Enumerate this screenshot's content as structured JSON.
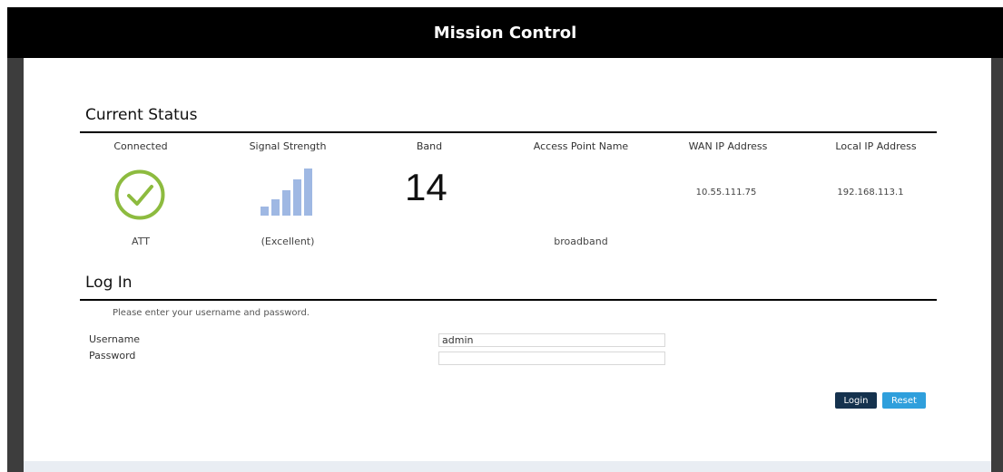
{
  "header": {
    "title": "Mission Control"
  },
  "status": {
    "title": "Current Status",
    "columns": {
      "connected": "Connected",
      "signal": "Signal Strength",
      "band": "Band",
      "apn": "Access Point Name",
      "wan": "WAN IP Address",
      "local": "Local IP Address"
    },
    "carrier": "ATT",
    "signal_quality": "(Excellent)",
    "band_value": "14",
    "apn_value": "broadband",
    "wan_ip": "10.55.111.75",
    "local_ip": "192.168.113.1",
    "icons": {
      "connected": "check-circle-icon",
      "signal": "signal-bars-icon"
    },
    "signal_bars_lit": 5,
    "signal_bars_total": 5
  },
  "login": {
    "title": "Log In",
    "hint": "Please enter your username and password.",
    "username_label": "Username",
    "password_label": "Password",
    "username_value": "admin",
    "password_value": "",
    "login_button": "Login",
    "reset_button": "Reset"
  },
  "colors": {
    "header_bg": "#000000",
    "check_green": "#8dbb3f",
    "signal_blue": "#9fb8e3",
    "login_btn": "#15324e",
    "reset_btn": "#2f9fdc"
  }
}
